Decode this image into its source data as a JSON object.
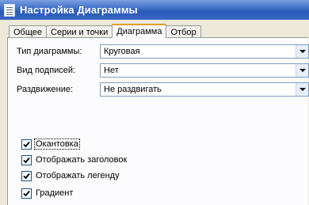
{
  "window": {
    "title": "Настройка Диаграммы"
  },
  "tabs": [
    {
      "label": "Общее"
    },
    {
      "label": "Серии и точки"
    },
    {
      "label": "Диаграмма"
    },
    {
      "label": "Отбор"
    }
  ],
  "fields": [
    {
      "label": "Тип диаграммы:",
      "value": "Круговая"
    },
    {
      "label": "Вид подписей:",
      "value": "Нет"
    },
    {
      "label": "Раздвижение:",
      "value": "Не раздвигать"
    }
  ],
  "checkboxes": [
    {
      "label": "Окантовка",
      "checked": true
    },
    {
      "label": "Отображать заголовок",
      "checked": true
    },
    {
      "label": "Отображать легенду",
      "checked": true
    },
    {
      "label": "Градиент",
      "checked": true
    }
  ]
}
